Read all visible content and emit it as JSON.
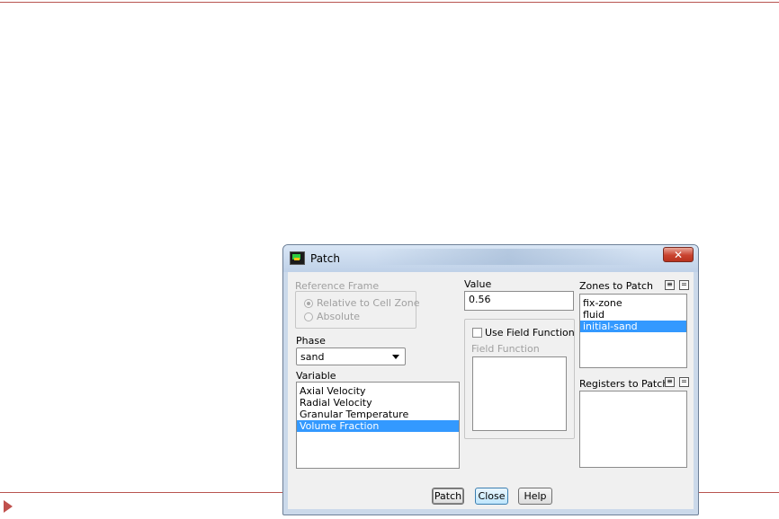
{
  "window": {
    "title": "Patch",
    "close_glyph": "✕"
  },
  "reference_frame": {
    "label": "Reference Frame",
    "options": [
      {
        "label": "Relative to Cell Zone",
        "selected": true
      },
      {
        "label": "Absolute",
        "selected": false
      }
    ]
  },
  "phase": {
    "label": "Phase",
    "selected": "sand"
  },
  "variable": {
    "label": "Variable",
    "items": [
      {
        "label": "Axial Velocity",
        "selected": false
      },
      {
        "label": "Radial Velocity",
        "selected": false
      },
      {
        "label": "Granular Temperature",
        "selected": false
      },
      {
        "label": "Volume Fraction",
        "selected": true
      }
    ]
  },
  "value": {
    "label": "Value",
    "current": "0.56"
  },
  "field_function": {
    "checkbox_label": "Use Field Function",
    "checked": false,
    "list_label": "Field Function"
  },
  "zones_to_patch": {
    "label": "Zones to Patch",
    "items": [
      {
        "label": "fix-zone",
        "selected": false
      },
      {
        "label": "fluid",
        "selected": false
      },
      {
        "label": "initial-sand",
        "selected": true
      }
    ]
  },
  "registers_to_patch": {
    "label": "Registers to Patch"
  },
  "buttons": {
    "patch": "Patch",
    "close": "Close",
    "help": "Help"
  },
  "icons": {
    "select_all": "list-select-all-icon",
    "deselect_all": "list-deselect-all-icon",
    "app": "fluent-app-icon"
  },
  "colors": {
    "selection": "#3399ff",
    "close_button": "#c9432f",
    "slide_accent": "#c0504d"
  }
}
